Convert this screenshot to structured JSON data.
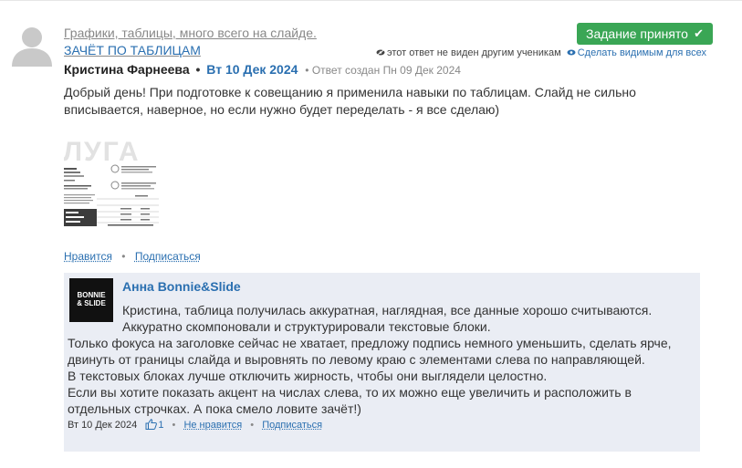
{
  "submission": {
    "title_line1": "Графики, таблицы, много всего на слайде.",
    "title_line2": "ЗАЧЁТ ПО ТАБЛИЦАМ",
    "status_badge": "Задание принято",
    "hidden_notice": "этот ответ не виден другим ученикам",
    "make_visible": "Сделать видимым для всех",
    "author": "Кристина Фарнеева",
    "date": "Вт 10 Дек 2024",
    "created": "Ответ создан Пн 09 Дек 2024",
    "text": "Добрый день! При подготовке к совещанию я применила навыки по таблицам. Слайд не сильно вписывается, наверное, но если нужно будет переделать - я все сделаю)",
    "attachment_heading": "ЛУГА",
    "like_label": "Нравится",
    "subscribe_label": "Подписаться"
  },
  "reply": {
    "logo_line1": "BONNIE",
    "logo_line2": "& SLIDE",
    "author": "Анна Bonnie&Slide",
    "lines": [
      "Кристина, таблица получилась аккуратная, наглядная, все данные хорошо считываются.",
      "Аккуратно скомпоновали и структурировали текстовые блоки.",
      "Только фокуса на заголовке сейчас не хватает, предложу подпись немного уменьшить, сделать ярче,",
      "двинуть от границы слайда и выровнять по левому краю с элементами слева по направляющей.",
      "В текстовых блоках лучше отключить жирность, чтобы они выглядели целостно.",
      "Если вы хотите показать акцент на числах слева, то их можно еще увеличить и расположить в",
      "отдельных строчках. А пока смело ловите зачёт!)"
    ],
    "date": "Вт 10 Дек 2024",
    "likes": "1",
    "dislike_label": "Не нравится",
    "subscribe_label": "Подписаться"
  },
  "colors": {
    "accent": "#2a6fb0",
    "success": "#3aa655",
    "reply_bg": "#eaedf4"
  },
  "icons": {
    "avatar": "user-silhouette-icon",
    "check": "check-icon",
    "eye_hidden": "eye-slash-icon",
    "eye": "eye-icon",
    "like": "thumbs-up-icon"
  }
}
